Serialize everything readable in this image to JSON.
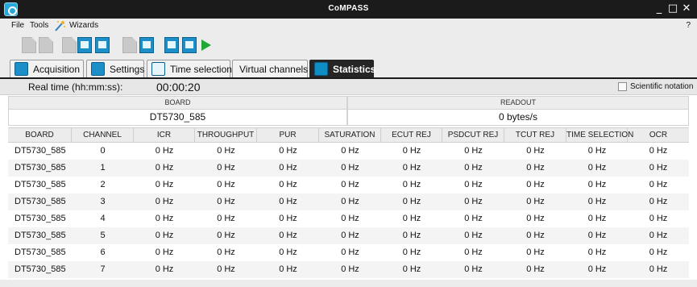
{
  "window": {
    "title": "CoMPASS",
    "minimize": "_",
    "maximize": "□",
    "close": "✕"
  },
  "menubar": {
    "file": "File",
    "tools": "Tools",
    "wizards": "Wizards",
    "help": "?"
  },
  "toolbar": {
    "buttons": [
      "new-doc",
      "open-doc",
      "save-doc",
      "save-as",
      "config",
      "export",
      "copy-config",
      "readout",
      "monitor",
      "start"
    ]
  },
  "tabs": [
    {
      "label": "Acquisition",
      "icon": "acquisition-icon",
      "active": false
    },
    {
      "label": "Settings",
      "icon": "gear-icon",
      "active": false
    },
    {
      "label": "Time selection",
      "icon": "waveform-icon",
      "active": false
    },
    {
      "label": "Virtual channels",
      "icon": "",
      "active": false
    },
    {
      "label": "Statistics",
      "icon": "statistics-icon",
      "active": true
    }
  ],
  "realtime": {
    "label": "Real time (hh:mm:ss):",
    "value": "00:00:20",
    "scientific_label": "Scientific notation",
    "scientific_checked": false
  },
  "summary": {
    "board_header": "BOARD",
    "readout_header": "READOUT",
    "board_value": "DT5730_585",
    "readout_value": "0 bytes/s"
  },
  "table": {
    "columns": [
      "BOARD",
      "CHANNEL",
      "ICR",
      "THROUGHPUT",
      "PUR",
      "SATURATION",
      "ECUT REJ",
      "PSDCUT REJ",
      "TCUT REJ",
      "TIME SELECTION",
      "OCR"
    ],
    "rows": [
      [
        "DT5730_585",
        "0",
        "0 Hz",
        "0 Hz",
        "0 Hz",
        "0 Hz",
        "0 Hz",
        "0 Hz",
        "0 Hz",
        "0 Hz",
        "0 Hz"
      ],
      [
        "DT5730_585",
        "1",
        "0 Hz",
        "0 Hz",
        "0 Hz",
        "0 Hz",
        "0 Hz",
        "0 Hz",
        "0 Hz",
        "0 Hz",
        "0 Hz"
      ],
      [
        "DT5730_585",
        "2",
        "0 Hz",
        "0 Hz",
        "0 Hz",
        "0 Hz",
        "0 Hz",
        "0 Hz",
        "0 Hz",
        "0 Hz",
        "0 Hz"
      ],
      [
        "DT5730_585",
        "3",
        "0 Hz",
        "0 Hz",
        "0 Hz",
        "0 Hz",
        "0 Hz",
        "0 Hz",
        "0 Hz",
        "0 Hz",
        "0 Hz"
      ],
      [
        "DT5730_585",
        "4",
        "0 Hz",
        "0 Hz",
        "0 Hz",
        "0 Hz",
        "0 Hz",
        "0 Hz",
        "0 Hz",
        "0 Hz",
        "0 Hz"
      ],
      [
        "DT5730_585",
        "5",
        "0 Hz",
        "0 Hz",
        "0 Hz",
        "0 Hz",
        "0 Hz",
        "0 Hz",
        "0 Hz",
        "0 Hz",
        "0 Hz"
      ],
      [
        "DT5730_585",
        "6",
        "0 Hz",
        "0 Hz",
        "0 Hz",
        "0 Hz",
        "0 Hz",
        "0 Hz",
        "0 Hz",
        "0 Hz",
        "0 Hz"
      ],
      [
        "DT5730_585",
        "7",
        "0 Hz",
        "0 Hz",
        "0 Hz",
        "0 Hz",
        "0 Hz",
        "0 Hz",
        "0 Hz",
        "0 Hz",
        "0 Hz"
      ]
    ]
  }
}
